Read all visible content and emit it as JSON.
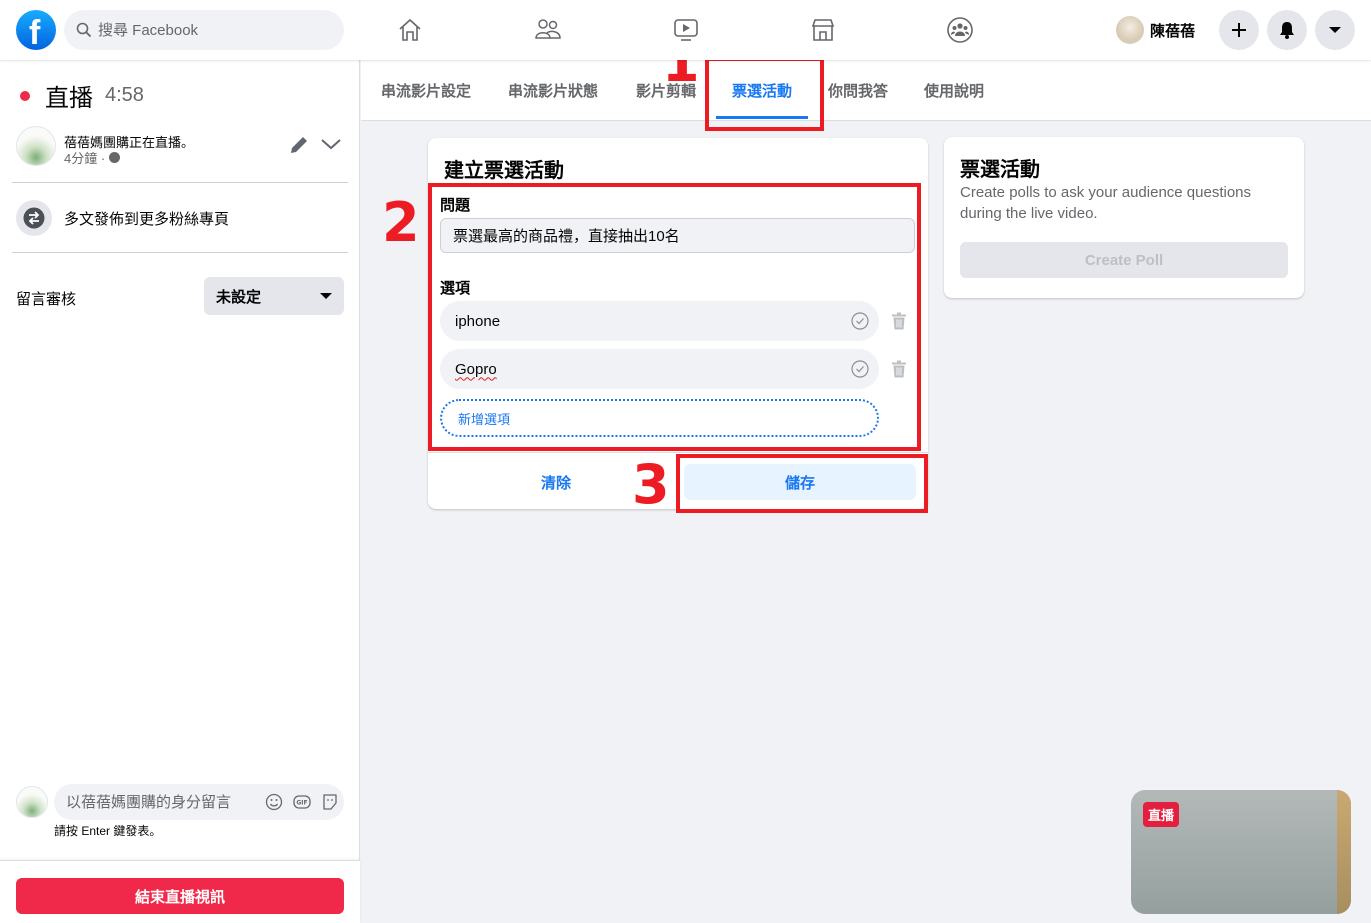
{
  "topbar": {
    "logo": "facebook-logo",
    "logo_glyph": "f",
    "search_placeholder": "搜尋 Facebook",
    "nav_icons": [
      "home-icon",
      "friends-icon",
      "watch-icon",
      "marketplace-icon",
      "groups-icon"
    ],
    "profile_name": "陳蓓蓓",
    "buttons": [
      "create-icon",
      "notifications-icon",
      "account-menu-icon"
    ]
  },
  "left": {
    "live_label": "直播",
    "live_time": "4:58",
    "page_status": "蓓蓓媽團購正在直播。",
    "page_meta": "4分鐘 · ",
    "crosspost_label": "多文發佈到更多粉絲專頁",
    "moderation_label": "留言審核",
    "moderation_value": "未設定",
    "comment_placeholder": "以蓓蓓媽團購的身分留言",
    "comment_hint": "請按 Enter 鍵發表。",
    "end_button": "結束直播視訊"
  },
  "tabs": [
    {
      "label": "串流影片設定",
      "active": false
    },
    {
      "label": "串流影片狀態",
      "active": false
    },
    {
      "label": "影片剪輯",
      "active": false
    },
    {
      "label": "票選活動",
      "active": true
    },
    {
      "label": "你問我答",
      "active": false
    },
    {
      "label": "使用說明",
      "active": false
    }
  ],
  "poll_form": {
    "title": "建立票選活動",
    "question_label": "問題",
    "question_value": "票選最高的商品禮，直接抽出10名",
    "options_label": "選項",
    "options": [
      "iphone",
      "Gopro"
    ],
    "add_option_placeholder": "新增選項",
    "clear_button": "清除",
    "save_button": "儲存"
  },
  "info_card": {
    "title": "票選活動",
    "description": "Create polls to ask your audience questions during the live video.",
    "create_button": "Create Poll"
  },
  "preview": {
    "badge": "直播"
  },
  "annotations": {
    "step1": "1",
    "step2": "2",
    "step3": "3",
    "color": "#ed1c24"
  },
  "colors": {
    "brand": "#1877f2",
    "live_red": "#f02849",
    "background": "#f0f2f5"
  }
}
